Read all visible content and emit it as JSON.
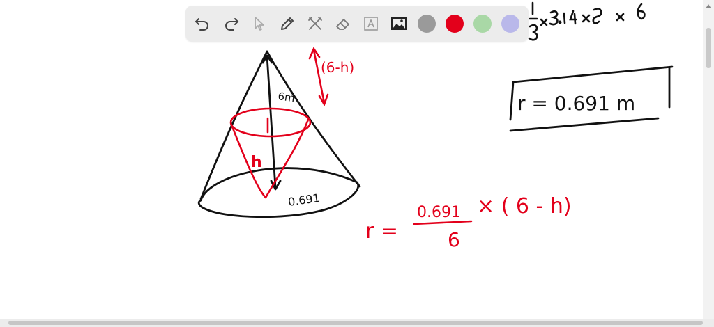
{
  "toolbar": {
    "tools": [
      "undo-icon",
      "redo-icon",
      "select-icon",
      "pen-icon",
      "tools-icon",
      "eraser-icon",
      "text-icon",
      "image-icon"
    ],
    "colors": {
      "gray": "#9a9a9a",
      "red": "#e3001b",
      "green": "#a9d8a6",
      "lavender": "#b9b8ea"
    },
    "active_color": "red"
  },
  "annotations": {
    "formula_top": "1/3 × 3.14 × r × 6",
    "slant_label": "6m",
    "height_gap": "(6-h)",
    "inner_h": "h",
    "base_radius": "0.691",
    "boxed_result": "r = 0.691 m",
    "ratio_lhs": "r =",
    "ratio_num": "0.691",
    "ratio_den": "6",
    "ratio_rhs": "× ( 6 - h)"
  }
}
